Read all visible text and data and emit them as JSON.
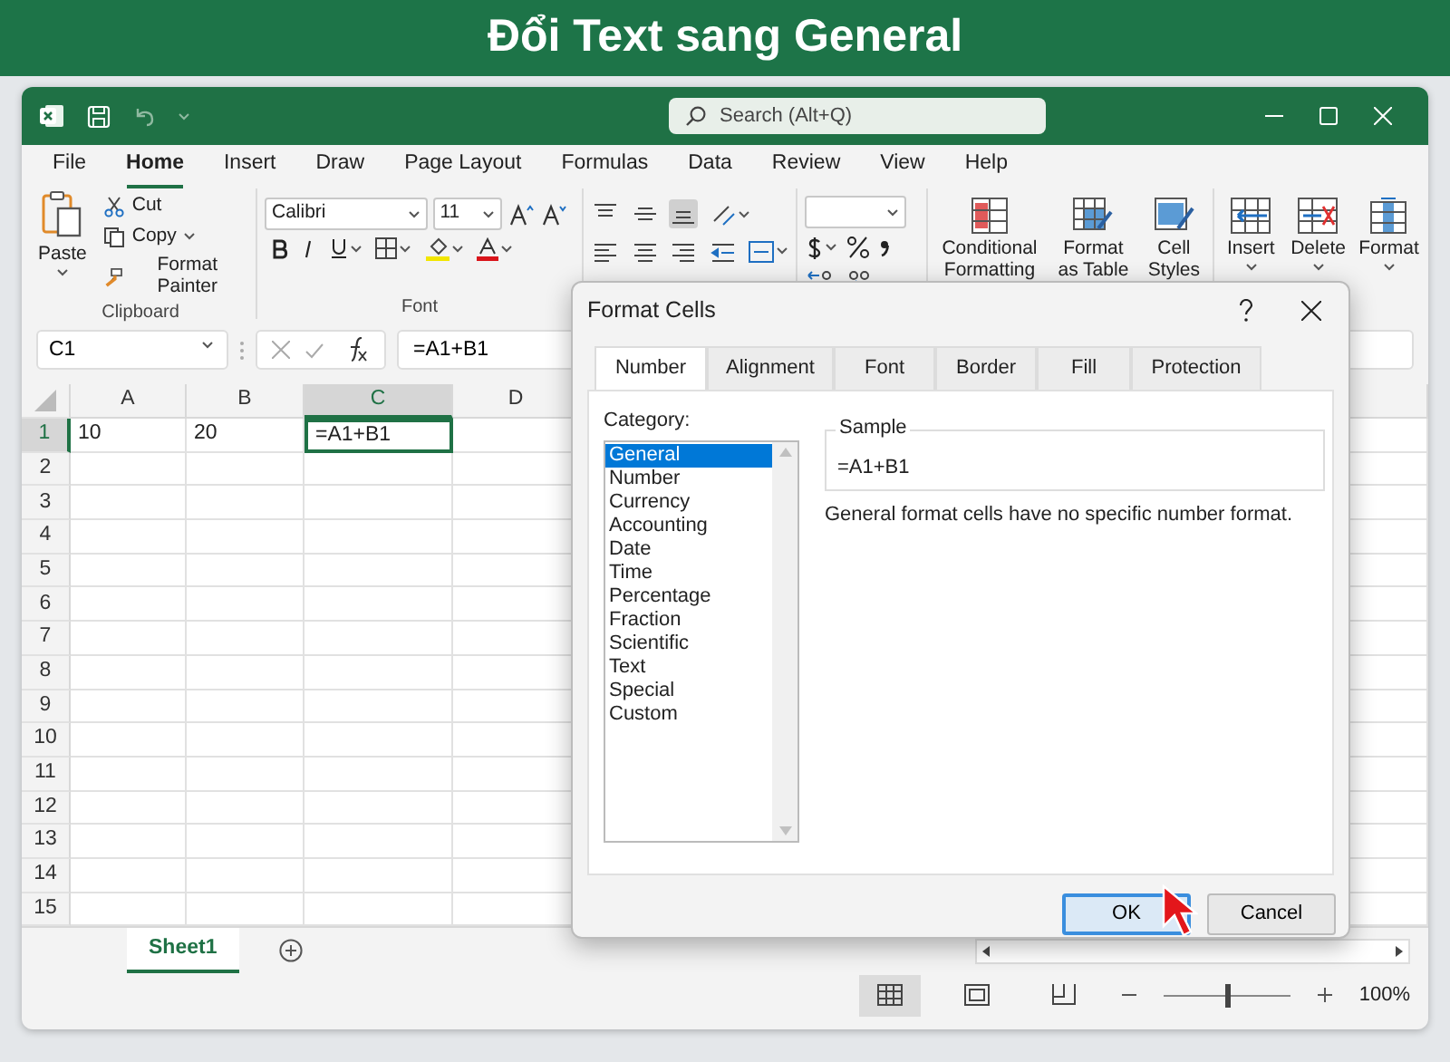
{
  "banner": {
    "title": "Đổi Text sang General"
  },
  "title_bar": {
    "search_placeholder": "Search (Alt+Q)"
  },
  "menu_tabs": [
    {
      "label": "File",
      "selected": false
    },
    {
      "label": "Home",
      "selected": true
    },
    {
      "label": "Insert",
      "selected": false
    },
    {
      "label": "Draw",
      "selected": false
    },
    {
      "label": "Page Layout",
      "selected": false
    },
    {
      "label": "Formulas",
      "selected": false
    },
    {
      "label": "Data",
      "selected": false
    },
    {
      "label": "Review",
      "selected": false
    },
    {
      "label": "View",
      "selected": false
    },
    {
      "label": "Help",
      "selected": false
    }
  ],
  "ribbon": {
    "clipboard": {
      "paste": "Paste",
      "cut": "Cut",
      "copy": "Copy",
      "format_painter": "Format Painter",
      "label": "Clipboard"
    },
    "font": {
      "name": "Calibri",
      "size": "11",
      "label": "Font"
    },
    "styles": [
      {
        "label": "Conditional Formatting",
        "kind": "conditional"
      },
      {
        "label": "Format as Table",
        "kind": "table"
      },
      {
        "label": "Cell Styles",
        "kind": "styles"
      }
    ],
    "cells": [
      {
        "label": "Insert",
        "kind": "insert"
      },
      {
        "label": "Delete",
        "kind": "delete"
      },
      {
        "label": "Format",
        "kind": "format"
      }
    ]
  },
  "formula_bar": {
    "name_box": "C1",
    "formula": "=A1+B1"
  },
  "grid": {
    "columns": [
      {
        "label": "A",
        "selected": false
      },
      {
        "label": "B",
        "selected": false
      },
      {
        "label": "C",
        "selected": true
      },
      {
        "label": "D",
        "selected": false
      }
    ],
    "rows": [
      {
        "label": "1",
        "selected": true,
        "cells": [
          {
            "value": "10",
            "active": false
          },
          {
            "value": "20",
            "active": false
          },
          {
            "value": "=A1+B1",
            "active": true
          }
        ]
      },
      {
        "label": "2",
        "selected": false
      },
      {
        "label": "3",
        "selected": false
      },
      {
        "label": "4",
        "selected": false
      },
      {
        "label": "5",
        "selected": false
      },
      {
        "label": "6",
        "selected": false
      },
      {
        "label": "7",
        "selected": false
      },
      {
        "label": "8",
        "selected": false
      },
      {
        "label": "9",
        "selected": false
      },
      {
        "label": "10",
        "selected": false
      },
      {
        "label": "11",
        "selected": false
      },
      {
        "label": "12",
        "selected": false
      },
      {
        "label": "13",
        "selected": false
      },
      {
        "label": "14",
        "selected": false
      },
      {
        "label": "15",
        "selected": false
      }
    ]
  },
  "sheet_tabs": [
    {
      "label": "Sheet1",
      "selected": true
    }
  ],
  "status_bar": {
    "views": [
      {
        "kind": "normal",
        "selected": true
      },
      {
        "kind": "page_layout",
        "selected": false
      },
      {
        "kind": "page_break",
        "selected": false
      }
    ],
    "zoom": {
      "level": 0.5,
      "reading": "100%"
    }
  },
  "dialog": {
    "title": "Format Cells",
    "tabs": [
      {
        "label": "Number",
        "selected": true
      },
      {
        "label": "Alignment",
        "selected": false
      },
      {
        "label": "Font",
        "selected": false
      },
      {
        "label": "Border",
        "selected": false
      },
      {
        "label": "Fill",
        "selected": false
      },
      {
        "label": "Protection",
        "selected": false
      }
    ],
    "category_label": "Category:",
    "categories": [
      {
        "label": "General",
        "selected": true
      },
      {
        "label": "Number",
        "selected": false
      },
      {
        "label": "Currency",
        "selected": false
      },
      {
        "label": "Accounting",
        "selected": false
      },
      {
        "label": "Date",
        "selected": false
      },
      {
        "label": "Time",
        "selected": false
      },
      {
        "label": "Percentage",
        "selected": false
      },
      {
        "label": "Fraction",
        "selected": false
      },
      {
        "label": "Scientific",
        "selected": false
      },
      {
        "label": "Text",
        "selected": false
      },
      {
        "label": "Special",
        "selected": false
      },
      {
        "label": "Custom",
        "selected": false
      }
    ],
    "sample_label": "Sample",
    "sample_value": "=A1+B1",
    "description": "General format cells have no specific number format.",
    "buttons": [
      {
        "label": "OK",
        "kind": "primary"
      },
      {
        "label": "Cancel",
        "kind": "secondary"
      }
    ]
  }
}
